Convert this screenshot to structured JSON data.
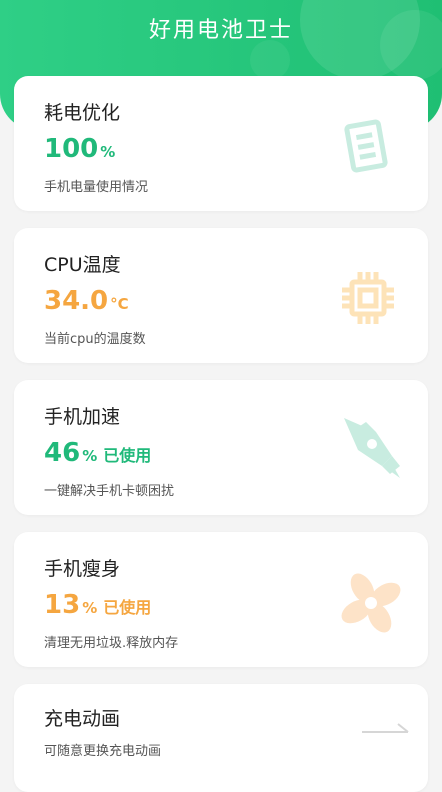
{
  "app": {
    "title": "好用电池卫士"
  },
  "cards": [
    {
      "name": "耗电优化",
      "value": "100",
      "unit": "%",
      "used": "",
      "desc": "手机电量使用情况",
      "icon": "battery-list-icon"
    },
    {
      "name": "CPU温度",
      "value": "34.0",
      "unit": "°C",
      "used": "",
      "desc": "当前cpu的温度数",
      "icon": "cpu-chip-icon"
    },
    {
      "name": "手机加速",
      "value": "46",
      "unit": "%",
      "used": "已使用",
      "desc": "一键解决手机卡顿困扰",
      "icon": "rocket-icon"
    },
    {
      "name": "手机瘦身",
      "value": "13",
      "unit": "%",
      "used": "已使用",
      "desc": "清理无用垃圾.释放内存",
      "icon": "fan-icon"
    },
    {
      "name": "充电动画",
      "value": "",
      "unit": "",
      "used": "",
      "desc": "可随意更换充电动画",
      "icon": "arrow-right-icon"
    }
  ],
  "colors": {
    "accent_green": "#20b97a",
    "accent_orange": "#f5a640"
  }
}
